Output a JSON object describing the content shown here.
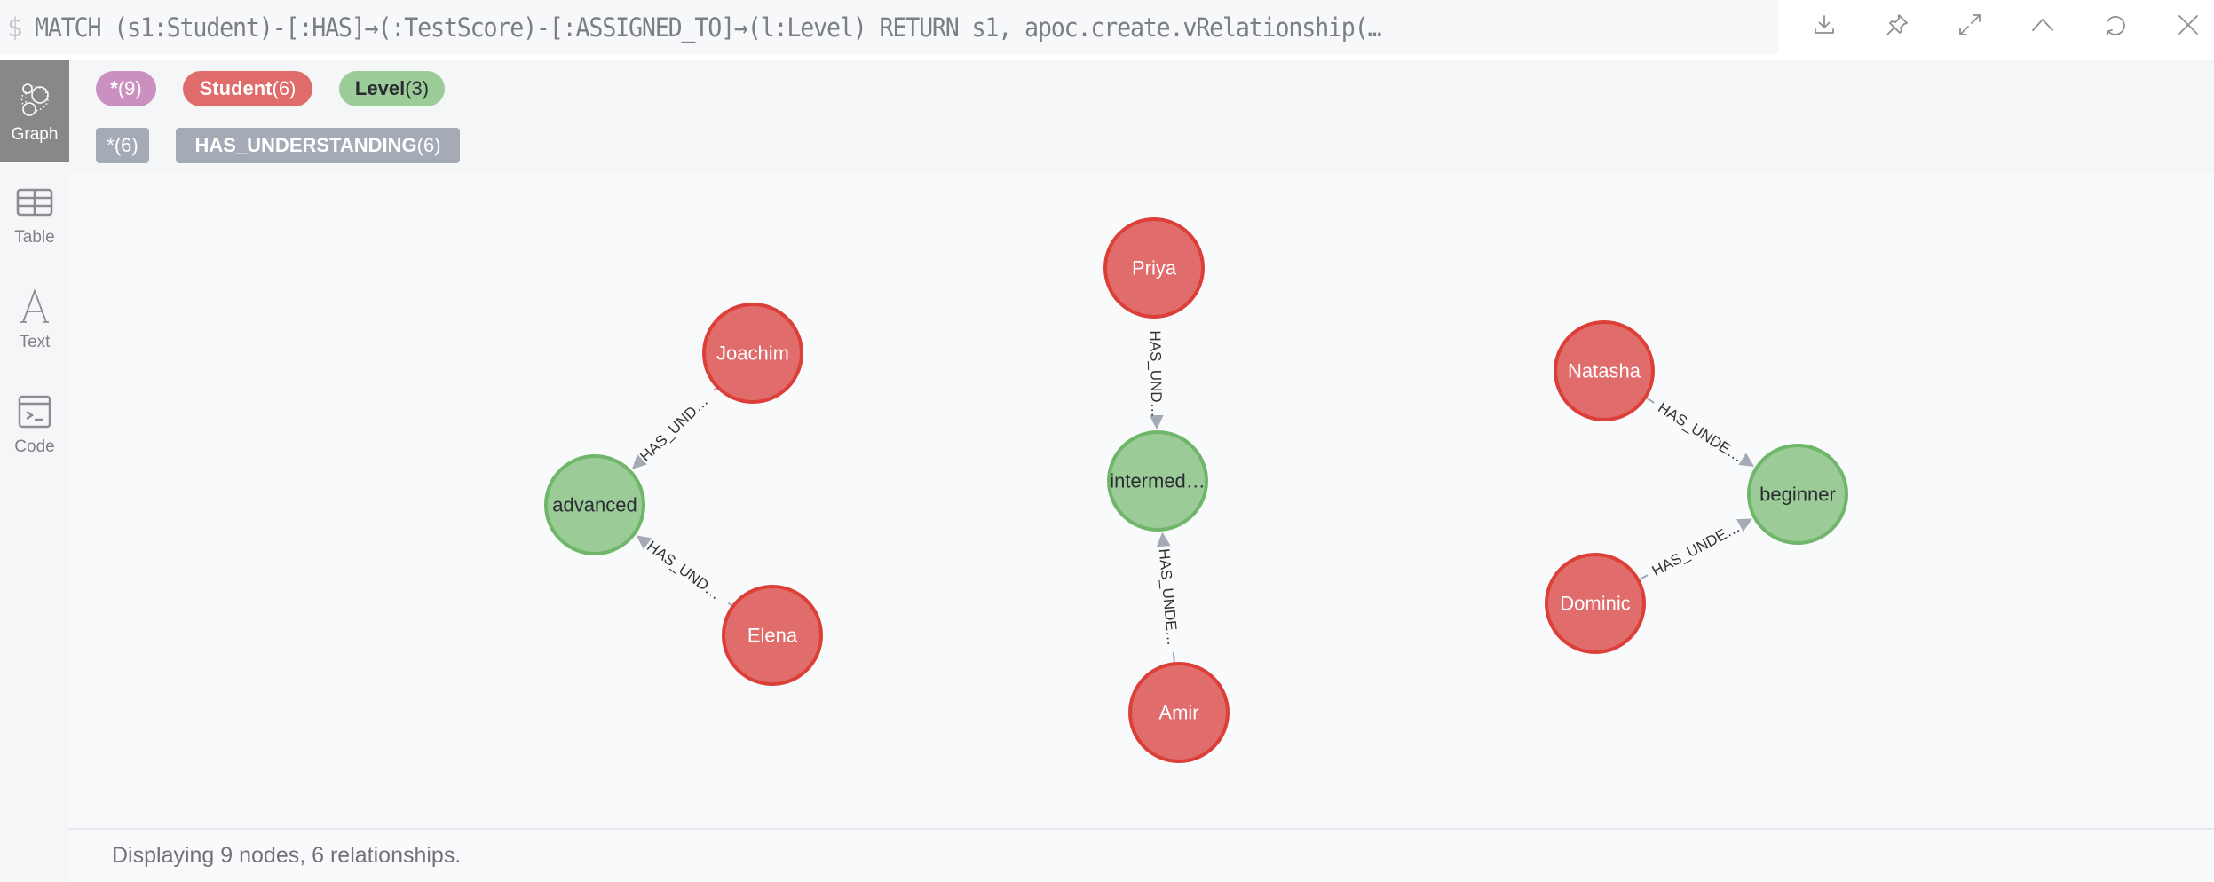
{
  "header": {
    "prompt": "$",
    "query": "MATCH (s1:Student)-[:HAS]→(:TestScore)-[:ASSIGNED_TO]→(l:Level) RETURN s1, apoc.create.vRelationship(…",
    "actions": [
      {
        "name": "download-icon",
        "label": "Export"
      },
      {
        "name": "pin-icon",
        "label": "Pin"
      },
      {
        "name": "expand-icon",
        "label": "Fullscreen"
      },
      {
        "name": "chevron-up-icon",
        "label": "Collapse"
      },
      {
        "name": "refresh-icon",
        "label": "Rerun"
      },
      {
        "name": "close-icon",
        "label": "Close"
      }
    ]
  },
  "sidebar": {
    "items": [
      {
        "label": "Graph",
        "icon": "graph-icon",
        "active": true
      },
      {
        "label": "Table",
        "icon": "table-icon",
        "active": false
      },
      {
        "label": "Text",
        "icon": "text-icon",
        "active": false
      },
      {
        "label": "Code",
        "icon": "code-icon",
        "active": false
      }
    ]
  },
  "legend": {
    "node_labels": [
      {
        "name": "*",
        "count": "(9)",
        "color": "#c990c0",
        "text_color": "#ffffff"
      },
      {
        "name": "Student",
        "count": "(6)",
        "color": "#e06b6b",
        "text_color": "#ffffff"
      },
      {
        "name": "Level",
        "count": "(3)",
        "color": "#9ccc97",
        "text_color": "#2a2c33"
      }
    ],
    "relationship_types": [
      {
        "name": "*",
        "count": "(6)",
        "color": "#a5abb6"
      },
      {
        "name": "HAS_UNDERSTANDING",
        "count": "(6)",
        "color": "#a5abb6"
      }
    ]
  },
  "colors": {
    "student_fill": "#e06c6b",
    "student_stroke": "#dc3f38",
    "level_fill": "#9bcb96",
    "level_stroke": "#6fb66a",
    "edge": "#a5abb6"
  },
  "graph": {
    "nodes": [
      {
        "id": "joachim",
        "label": "Joachim",
        "type": "Student"
      },
      {
        "id": "elena",
        "label": "Elena",
        "type": "Student"
      },
      {
        "id": "advanced",
        "label": "advanced",
        "type": "Level"
      },
      {
        "id": "priya",
        "label": "Priya",
        "type": "Student"
      },
      {
        "id": "amir",
        "label": "Amir",
        "type": "Student"
      },
      {
        "id": "intermediate",
        "label": "intermed…",
        "type": "Level"
      },
      {
        "id": "natasha",
        "label": "Natasha",
        "type": "Student"
      },
      {
        "id": "dominic",
        "label": "Dominic",
        "type": "Student"
      },
      {
        "id": "beginner",
        "label": "beginner",
        "type": "Level"
      }
    ],
    "edges": [
      {
        "from": "joachim",
        "to": "advanced",
        "label": "HAS_UND…"
      },
      {
        "from": "elena",
        "to": "advanced",
        "label": "HAS_UND…"
      },
      {
        "from": "priya",
        "to": "intermediate",
        "label": "HAS_UND…"
      },
      {
        "from": "amir",
        "to": "intermediate",
        "label": "HAS_UNDE…"
      },
      {
        "from": "natasha",
        "to": "beginner",
        "label": "HAS_UNDE…"
      },
      {
        "from": "dominic",
        "to": "beginner",
        "label": "HAS_UNDE…"
      }
    ]
  },
  "status": {
    "text": "Displaying 9 nodes, 6 relationships."
  }
}
